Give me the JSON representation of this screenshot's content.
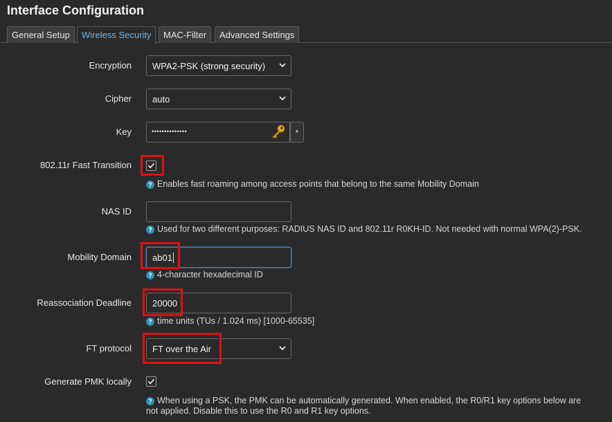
{
  "page": {
    "title": "Interface Configuration"
  },
  "tabs": [
    {
      "label": "General Setup",
      "active": false
    },
    {
      "label": "Wireless Security",
      "active": true
    },
    {
      "label": "MAC-Filter",
      "active": false
    },
    {
      "label": "Advanced Settings",
      "active": false
    }
  ],
  "form": {
    "encryption": {
      "label": "Encryption",
      "value": "WPA2-PSK (strong security)"
    },
    "cipher": {
      "label": "Cipher",
      "value": "auto"
    },
    "key": {
      "label": "Key",
      "value": "••••••••••••••",
      "reveal": "*",
      "icon": "key-icon"
    },
    "fast_transition": {
      "label": "802.11r Fast Transition",
      "checked": true,
      "help": "Enables fast roaming among access points that belong to the same Mobility Domain"
    },
    "nas_id": {
      "label": "NAS ID",
      "value": "",
      "help": "Used for two different purposes: RADIUS NAS ID and 802.11r R0KH-ID. Not needed with normal WPA(2)-PSK."
    },
    "mobility_domain": {
      "label": "Mobility Domain",
      "value": "ab01",
      "help": "4-character hexadecimal ID"
    },
    "reassociation_deadline": {
      "label": "Reassociation Deadline",
      "value": "20000",
      "help": "time units (TUs / 1.024 ms) [1000-65535]"
    },
    "ft_protocol": {
      "label": "FT protocol",
      "value": "FT over the Air"
    },
    "generate_pmk": {
      "label": "Generate PMK locally",
      "checked": true,
      "help_line1": "When using a PSK, the PMK can be automatically generated. When enabled, the R0/R1 key options below are",
      "help_line2": "not applied. Disable this to use the R0 and R1 key options."
    }
  },
  "colors": {
    "accent": "#6fb4e8",
    "highlight": "#e01010",
    "help_icon": "#2f8fb0"
  }
}
